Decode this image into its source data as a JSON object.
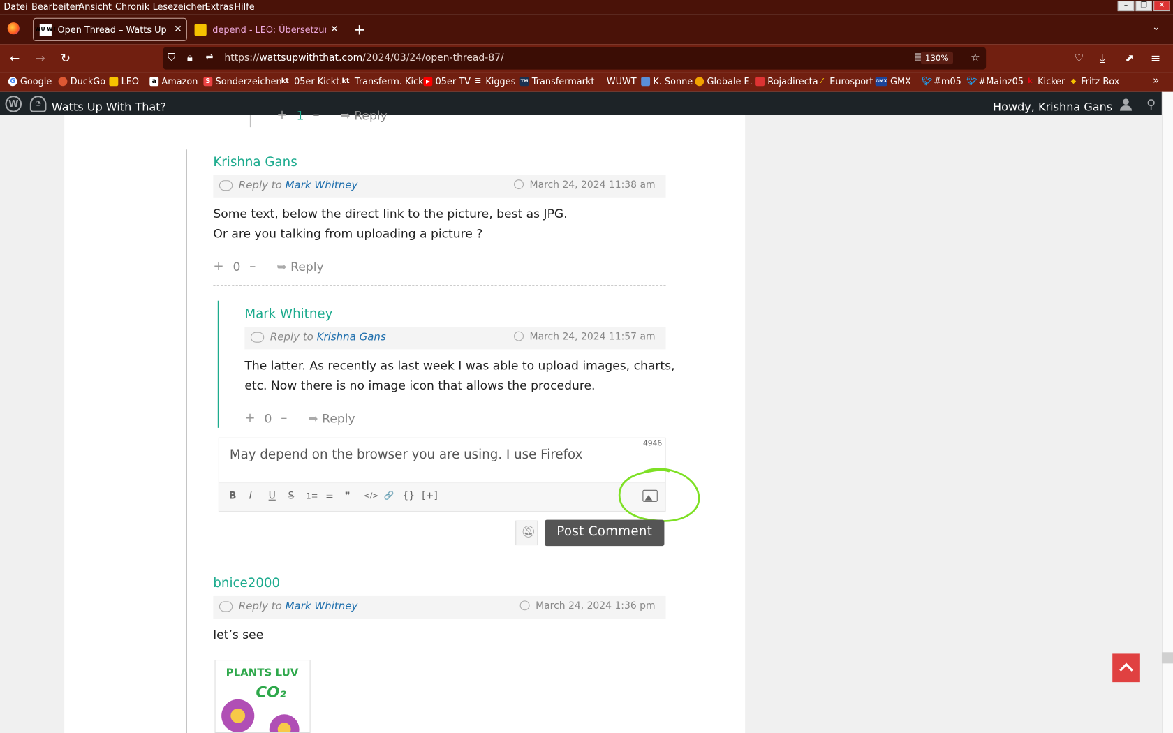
{
  "menu": {
    "items": [
      "Datei",
      "Bearbeiten",
      "Ansicht",
      "Chronik",
      "Lesezeichen",
      "Extras",
      "Hilfe"
    ]
  },
  "tabs": [
    {
      "title": "Open Thread – Watts Up With T",
      "favicon": "WU WT"
    },
    {
      "title": "depend - LEO: Übersetzung im"
    }
  ],
  "url": {
    "prefix": "https://",
    "domain": "wattsupwiththat.com",
    "path": "/2024/03/24/open-thread-87/",
    "zoom": "130%"
  },
  "bookmarks": [
    "Google",
    "DuckGo",
    "LEO",
    "Amazon",
    "Sonderzeichen",
    "05er Kickt.",
    "Transferm. Kickt.",
    "05er TV",
    "Kigges",
    "Transfermarkt",
    "WUWT",
    "K. Sonne",
    "Globale E.",
    "Rojadirecta",
    "Eurosport",
    "GMX",
    "#m05",
    "#Mainz05",
    "Kicker",
    "Fritz Box"
  ],
  "wpbar": {
    "site_name": "Watts Up With That?",
    "howdy": "Howdy, Krishna Gans"
  },
  "comments": [
    {
      "author": "Krishna Gans",
      "reply_prefix": "Reply to",
      "reply_to": "Mark Whitney",
      "date": "March 24, 2024 11:38 am",
      "lines": [
        "Some text, below the direct link to the picture, best as JPG.",
        "Or are you talking from uploading a picture ?"
      ],
      "votes": "0",
      "reply_label": "Reply"
    },
    {
      "author": "Mark Whitney",
      "reply_prefix": "Reply to",
      "reply_to": "Krishna Gans",
      "date": "March 24, 2024 11:57 am",
      "lines": [
        "The latter. As recently as last week I was able to upload images, charts,",
        "etc. Now there is no image icon that allows the procedure."
      ],
      "votes": "0",
      "reply_label": "Reply"
    },
    {
      "author": "bnice2000",
      "reply_prefix": "Reply to",
      "reply_to": "Mark Whitney",
      "date": "March 24, 2024 1:36 pm",
      "lines": [
        "let’s see"
      ]
    }
  ],
  "top_partial": {
    "votes": "1",
    "reply_label": "Reply"
  },
  "editor": {
    "char_count": "4946",
    "typed_text": "May depend on the browser you are using. I use Firefox",
    "toolbar": [
      "B",
      "I",
      "U",
      "S",
      "1≡",
      "≡",
      "❞",
      "</>",
      "🔗",
      "{}",
      "[+]"
    ]
  },
  "post_button": "Post Comment",
  "image_thumb": {
    "line1": "PLANTS LUV",
    "line2": "CO₂"
  },
  "annotation": {
    "color": "#7ee025"
  }
}
